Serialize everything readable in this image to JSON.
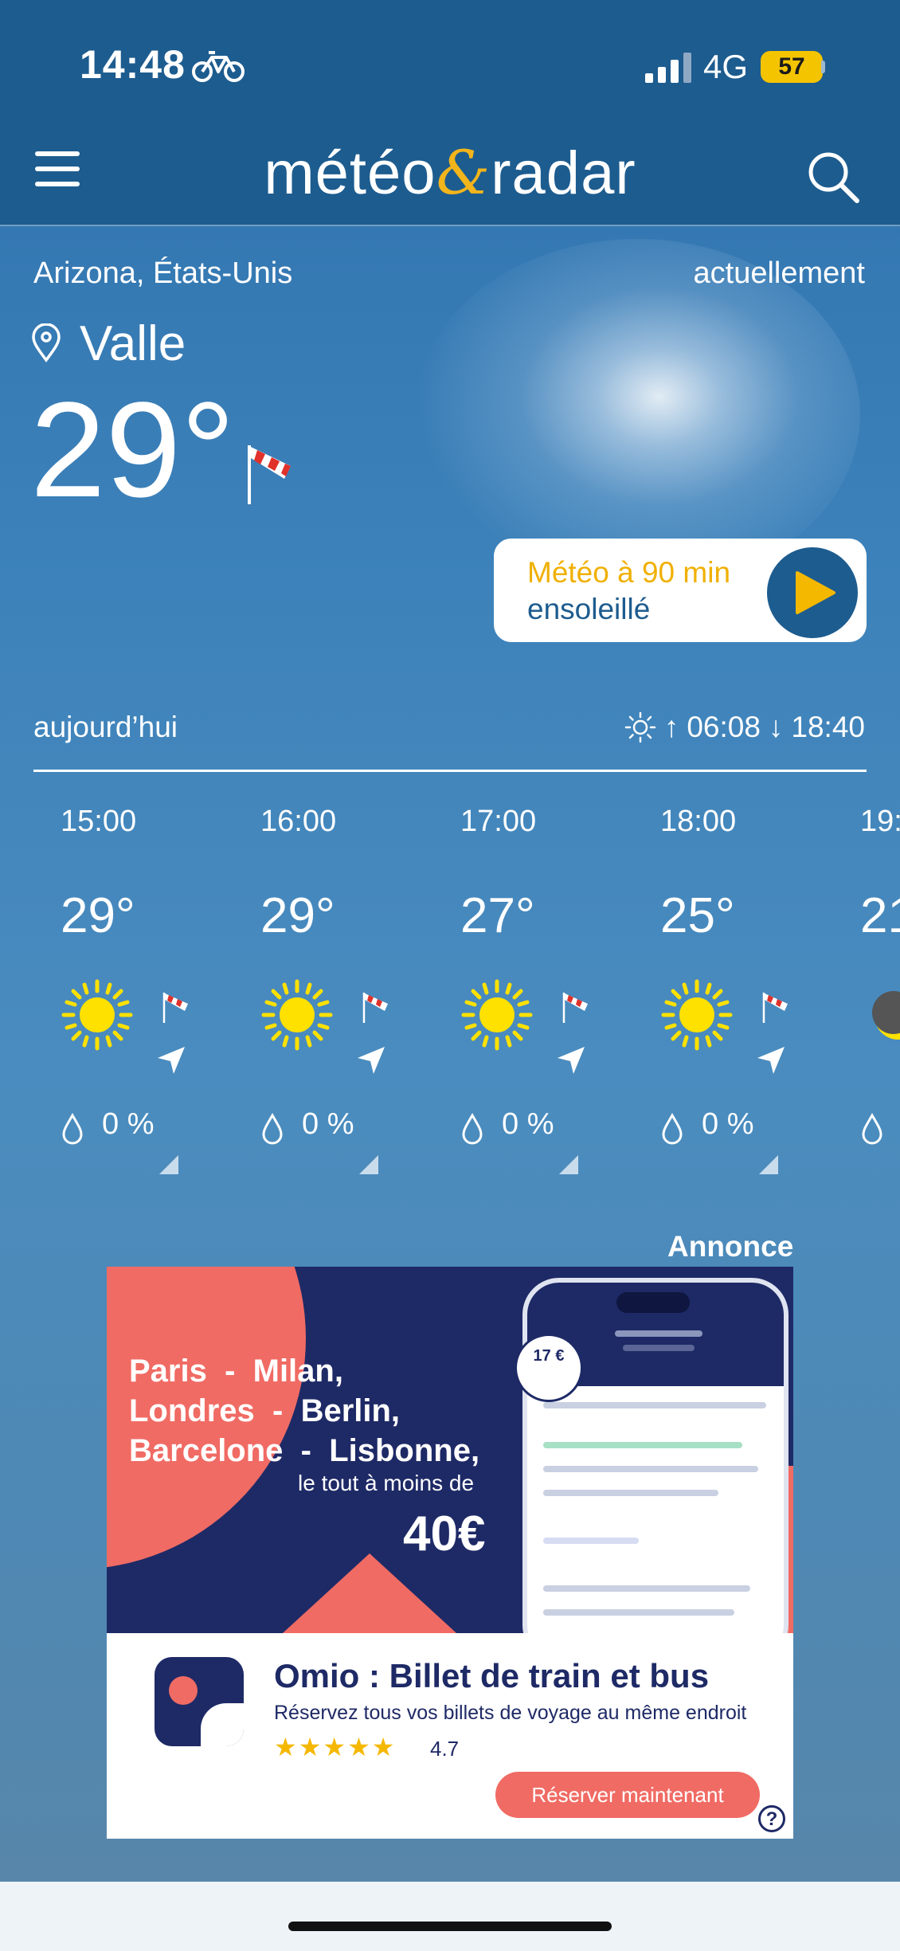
{
  "status_bar": {
    "time": "14:48",
    "network": "4G",
    "battery": "57"
  },
  "header": {
    "logo_part1": "météo",
    "logo_amp": "&",
    "logo_part2": "radar"
  },
  "location": {
    "region": "Arizona, États-Unis",
    "city": "Valle",
    "time_label": "actuellement"
  },
  "current": {
    "temperature": "29°"
  },
  "radar_card": {
    "title": "Météo à 90 min",
    "subtitle": "ensoleillé"
  },
  "today": {
    "label": "aujourd’hui",
    "sunrise": "06:08",
    "sunset": "18:40"
  },
  "hourly": [
    {
      "time": "15:00",
      "temp": "29°",
      "precip": "0 %",
      "icon": "sun-icon"
    },
    {
      "time": "16:00",
      "temp": "29°",
      "precip": "0 %",
      "icon": "sun-icon"
    },
    {
      "time": "17:00",
      "temp": "27°",
      "precip": "0 %",
      "icon": "sun-icon"
    },
    {
      "time": "18:00",
      "temp": "25°",
      "precip": "0 %",
      "icon": "sun-icon"
    },
    {
      "time": "19:",
      "temp": "21",
      "precip": "",
      "icon": "moon-icon"
    }
  ],
  "ad": {
    "label": "Annonce",
    "cities_line1": "Paris  -  Milan,",
    "cities_line2": "Londres  -  Berlin,",
    "cities_line3": "Barcelone  -  Lisbonne,",
    "subline": "le tout à moins de",
    "price": "40€",
    "badge": "17 €",
    "app_title": "Omio : Billet de train et bus",
    "app_desc": "Réservez tous vos billets de voyage au même endroit",
    "stars": "★★★★★",
    "rating": "4.7",
    "cta": "Réserver maintenant",
    "help": "?"
  },
  "colors": {
    "header_bg": "#1d5c8f",
    "accent_yellow": "#f0b000",
    "ad_navy": "#1e2a66",
    "ad_coral": "#f06b64"
  }
}
